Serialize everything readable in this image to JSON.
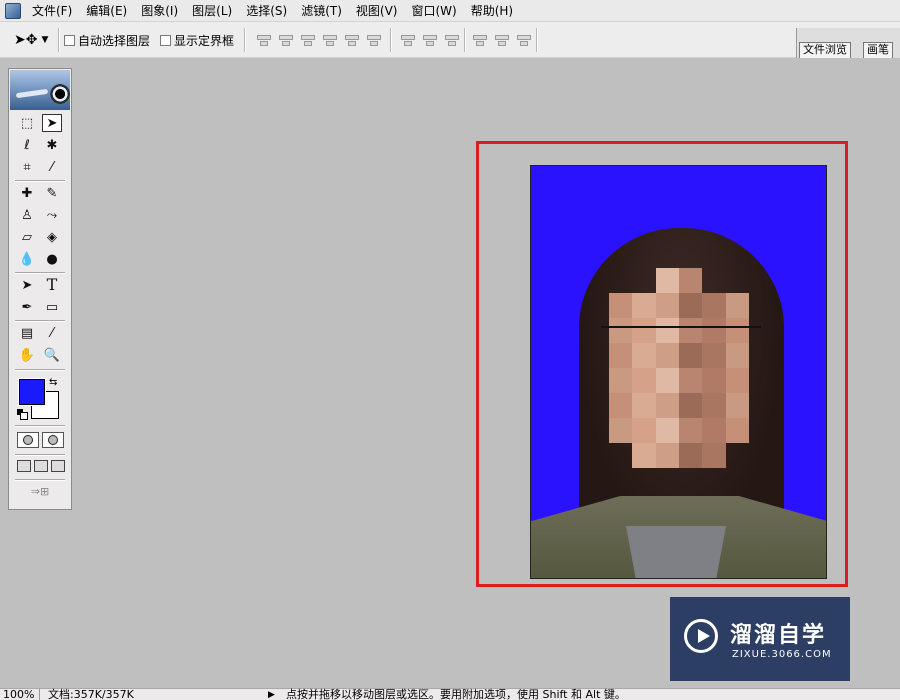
{
  "menu": [
    "文件(F)",
    "编辑(E)",
    "图象(I)",
    "图层(L)",
    "选择(S)",
    "滤镜(T)",
    "视图(V)",
    "窗口(W)",
    "帮助(H)"
  ],
  "options": {
    "tool_icon": "move-tool-icon",
    "auto_select_label": "自动选择图层",
    "show_bounds_label": "显示定界框",
    "auto_select_checked": false,
    "show_bounds_checked": false
  },
  "palette_tabs": [
    "文件浏览",
    "画笔"
  ],
  "toolbox": {
    "foreground_color": "#1a1aff",
    "background_color": "#ffffff",
    "tools": [
      "marquee-icon",
      "move-icon",
      "lasso-icon",
      "magic-wand-icon",
      "crop-icon",
      "slice-icon",
      "healing-brush-icon",
      "brush-icon",
      "clone-stamp-icon",
      "history-brush-icon",
      "eraser-icon",
      "paint-bucket-icon",
      "blur-icon",
      "dodge-icon",
      "path-select-icon",
      "type-icon",
      "pen-icon",
      "rectangle-icon",
      "notes-icon",
      "eyedropper-icon",
      "hand-icon",
      "zoom-icon"
    ],
    "type_tool_glyph": "T"
  },
  "document": {
    "highlight_color": "#d81e1e",
    "photo_background": "#2a12ff"
  },
  "watermark": {
    "title": "溜溜自学",
    "subtitle": "ZIXUE.3066.COM"
  },
  "status": {
    "zoom": "100%",
    "doc_info": "文档:357K/357K",
    "hint": "点按并拖移以移动图层或选区。要用附加选项，使用 Shift 和 Alt 键。"
  }
}
